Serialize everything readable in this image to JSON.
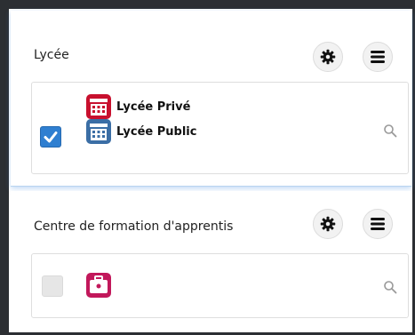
{
  "sections": [
    {
      "title": "Lycée",
      "checked": true,
      "entries": [
        {
          "label": "Lycée Privé",
          "icon": "building-icon",
          "color": "#c8102e"
        },
        {
          "label": "Lycée Public",
          "icon": "building-icon",
          "color": "#3b6ea5"
        }
      ]
    },
    {
      "title": "Centre de formation d'apprentis",
      "checked": false,
      "entries": [
        {
          "label": "",
          "icon": "briefcase-icon",
          "color": "#c2185b"
        }
      ]
    }
  ],
  "colors": {
    "checkbox_checked": "#2f7fd1",
    "highlight_shadow": "#4a90e2",
    "frame": "#2c2f33"
  }
}
